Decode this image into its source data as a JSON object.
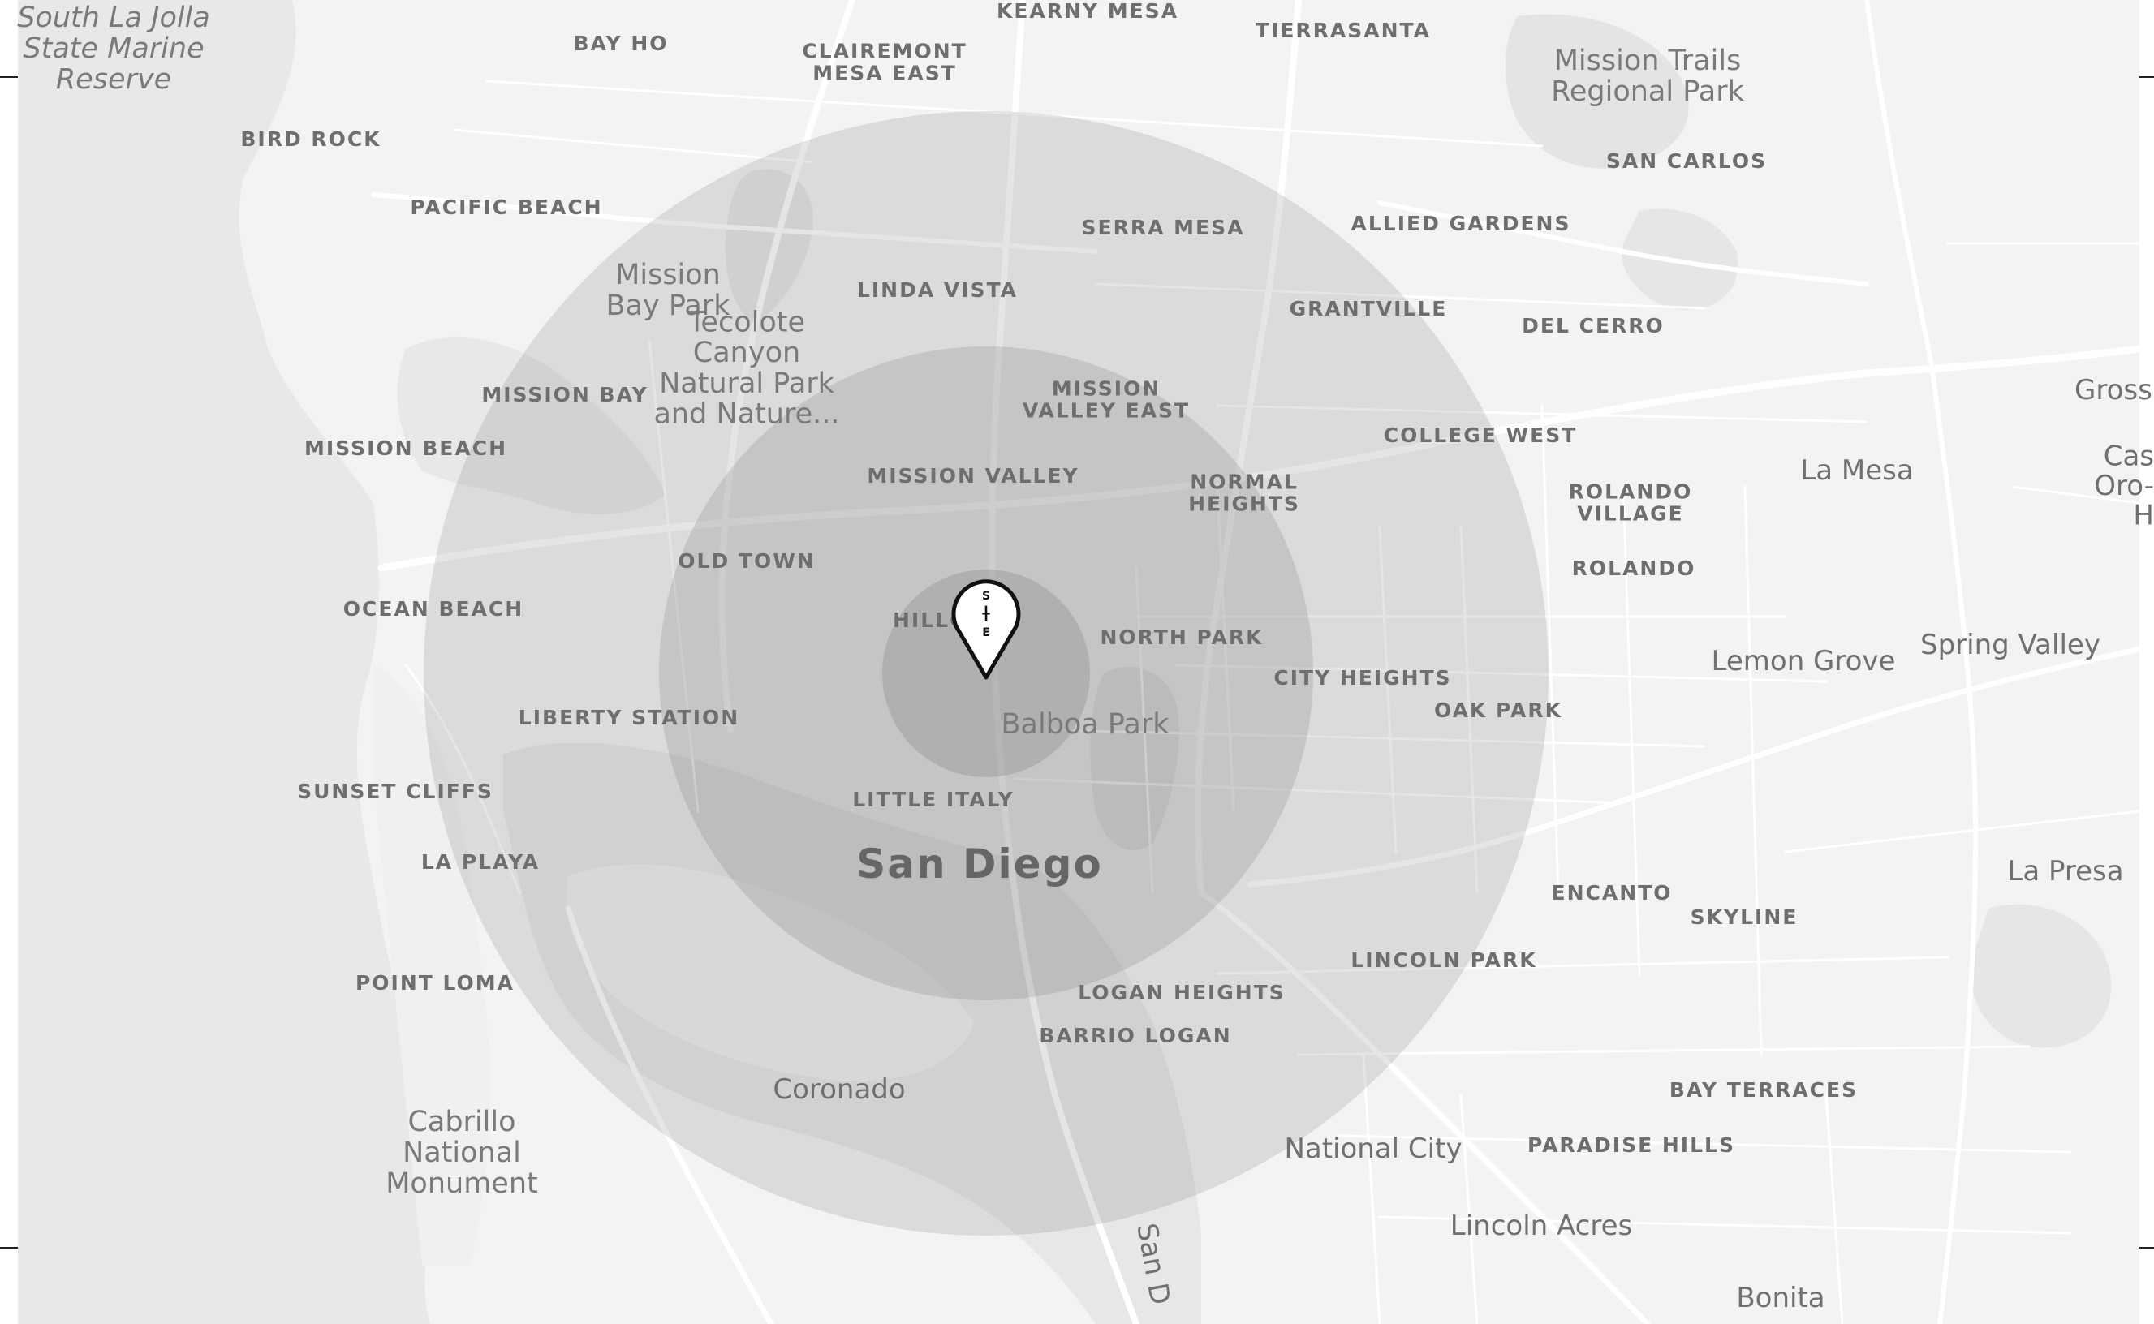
{
  "map": {
    "site_marker": {
      "letters": [
        "S",
        "I",
        "T",
        "E"
      ]
    },
    "colors": {
      "land": "#f2f2f2",
      "water": "#e9e9e9",
      "road": "#ffffff",
      "ring_fill": "#6e6e6e",
      "label": "#6e6e6e"
    },
    "labels": [
      {
        "id": "kearny-mesa",
        "text": "KEARNY MESA",
        "style": "nb"
      },
      {
        "id": "tierrasanta",
        "text": "TIERRASANTA",
        "style": "nb"
      },
      {
        "id": "bay-ho",
        "text": "BAY HO",
        "style": "nb"
      },
      {
        "id": "clairemont-mesa-east",
        "text": "CLAIREMONT\nMESA EAST",
        "style": "nb"
      },
      {
        "id": "south-la-jolla",
        "text": "South La Jolla\nState Marine\nReserve",
        "style": "park-i"
      },
      {
        "id": "mission-trails",
        "text": "Mission Trails\nRegional Park",
        "style": "park"
      },
      {
        "id": "bird-rock",
        "text": "BIRD ROCK",
        "style": "nb"
      },
      {
        "id": "san-carlos",
        "text": "SAN CARLOS",
        "style": "nb"
      },
      {
        "id": "pacific-beach",
        "text": "PACIFIC BEACH",
        "style": "nb"
      },
      {
        "id": "serra-mesa",
        "text": "SERRA MESA",
        "style": "nb"
      },
      {
        "id": "allied-gardens",
        "text": "ALLIED GARDENS",
        "style": "nb"
      },
      {
        "id": "mission-bay-park",
        "text": "Mission\nBay Park",
        "style": "park"
      },
      {
        "id": "linda-vista",
        "text": "LINDA VISTA",
        "style": "nb"
      },
      {
        "id": "grantville",
        "text": "GRANTVILLE",
        "style": "nb"
      },
      {
        "id": "del-cerro",
        "text": "DEL CERRO",
        "style": "nb"
      },
      {
        "id": "tecolote",
        "text": "Tecolote\nCanyon\nNatural Park\nand Nature...",
        "style": "park"
      },
      {
        "id": "grossmont",
        "text": "Grossmont",
        "style": "city"
      },
      {
        "id": "mission-bay",
        "text": "MISSION BAY",
        "style": "nb"
      },
      {
        "id": "mission-valley-east",
        "text": "MISSION\nVALLEY EAST",
        "style": "nb"
      },
      {
        "id": "mission-beach",
        "text": "MISSION BEACH",
        "style": "nb"
      },
      {
        "id": "college-west",
        "text": "COLLEGE WEST",
        "style": "nb"
      },
      {
        "id": "la-mesa",
        "text": "La Mesa",
        "style": "city"
      },
      {
        "id": "mission-valley",
        "text": "MISSION VALLEY",
        "style": "nb"
      },
      {
        "id": "normal-heights",
        "text": "NORMAL\nHEIGHTS",
        "style": "nb"
      },
      {
        "id": "rolando-village",
        "text": "ROLANDO\nVILLAGE",
        "style": "nb"
      },
      {
        "id": "casa-oro",
        "text": "Cas\nOro-\nH",
        "style": "city"
      },
      {
        "id": "old-town",
        "text": "OLD TOWN",
        "style": "nb"
      },
      {
        "id": "rolando",
        "text": "ROLANDO",
        "style": "nb"
      },
      {
        "id": "ocean-beach",
        "text": "OCEAN BEACH",
        "style": "nb"
      },
      {
        "id": "hillcrest",
        "text": "HILLC",
        "style": "nb"
      },
      {
        "id": "north-park",
        "text": "NORTH PARK",
        "style": "nb"
      },
      {
        "id": "spring-valley",
        "text": "Spring Valley",
        "style": "city"
      },
      {
        "id": "lemon-grove",
        "text": "Lemon Grove",
        "style": "city"
      },
      {
        "id": "city-heights",
        "text": "CITY HEIGHTS",
        "style": "nb"
      },
      {
        "id": "oak-park",
        "text": "OAK PARK",
        "style": "nb"
      },
      {
        "id": "liberty-station",
        "text": "LIBERTY STATION",
        "style": "nb"
      },
      {
        "id": "balboa-park",
        "text": "Balboa Park",
        "style": "park"
      },
      {
        "id": "sunset-cliffs",
        "text": "SUNSET CLIFFS",
        "style": "nb"
      },
      {
        "id": "little-italy",
        "text": "LITTLE ITALY",
        "style": "nb"
      },
      {
        "id": "la-playa",
        "text": "LA PLAYA",
        "style": "nb"
      },
      {
        "id": "san-diego",
        "text": "San Diego",
        "style": "big"
      },
      {
        "id": "la-presa",
        "text": "La Presa",
        "style": "city"
      },
      {
        "id": "encanto",
        "text": "ENCANTO",
        "style": "nb"
      },
      {
        "id": "skyline",
        "text": "SKYLINE",
        "style": "nb"
      },
      {
        "id": "lincoln-park",
        "text": "LINCOLN PARK",
        "style": "nb"
      },
      {
        "id": "point-loma",
        "text": "POINT LOMA",
        "style": "nb"
      },
      {
        "id": "logan-heights",
        "text": "LOGAN HEIGHTS",
        "style": "nb"
      },
      {
        "id": "barrio-logan",
        "text": "BARRIO LOGAN",
        "style": "nb"
      },
      {
        "id": "bay-terraces",
        "text": "BAY TERRACES",
        "style": "nb"
      },
      {
        "id": "coronado",
        "text": "Coronado",
        "style": "city"
      },
      {
        "id": "paradise-hills",
        "text": "PARADISE HILLS",
        "style": "nb"
      },
      {
        "id": "cabrillo",
        "text": "Cabrillo\nNational\nMonument",
        "style": "park"
      },
      {
        "id": "national-city",
        "text": "National City",
        "style": "city"
      },
      {
        "id": "lincoln-acres",
        "text": "Lincoln Acres",
        "style": "city"
      },
      {
        "id": "san-diego-road",
        "text": "San D",
        "style": "city"
      },
      {
        "id": "bonita",
        "text": "Bonita",
        "style": "city"
      }
    ]
  }
}
